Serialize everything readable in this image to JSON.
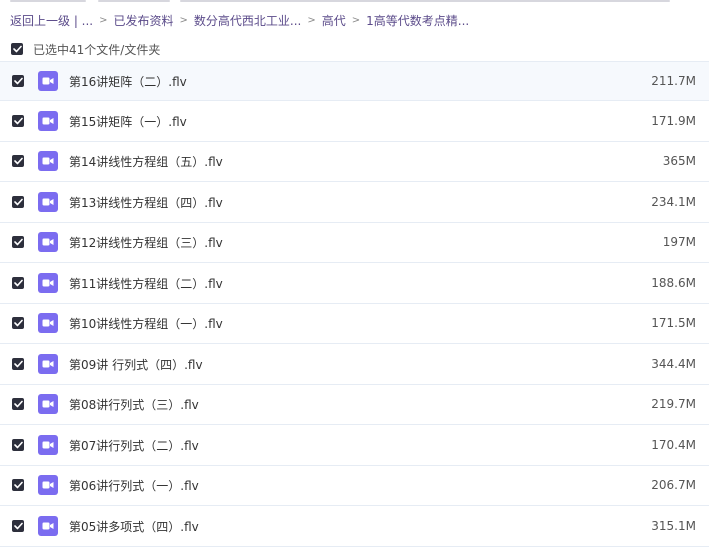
{
  "breadcrumb": {
    "items": [
      "返回上一级 | ...",
      "已发布资料",
      "数分高代西北工业...",
      "高代",
      "1高等代数考点精..."
    ],
    "separator": ">"
  },
  "selection": {
    "label": "已选中41个文件/文件夹"
  },
  "files": [
    {
      "name": "第16讲矩阵（二）.flv",
      "size": "211.7M"
    },
    {
      "name": "第15讲矩阵（一）.flv",
      "size": "171.9M"
    },
    {
      "name": "第14讲线性方程组（五）.flv",
      "size": "365M"
    },
    {
      "name": "第13讲线性方程组（四）.flv",
      "size": "234.1M"
    },
    {
      "name": "第12讲线性方程组（三）.flv",
      "size": "197M"
    },
    {
      "name": "第11讲线性方程组（二）.flv",
      "size": "188.6M"
    },
    {
      "name": "第10讲线性方程组（一）.flv",
      "size": "171.5M"
    },
    {
      "name": "第09讲 行列式（四）.flv",
      "size": "344.4M"
    },
    {
      "name": "第08讲行列式（三）.flv",
      "size": "219.7M"
    },
    {
      "name": "第07讲行列式（二）.flv",
      "size": "170.4M"
    },
    {
      "name": "第06讲行列式（一）.flv",
      "size": "206.7M"
    },
    {
      "name": "第05讲多项式（四）.flv",
      "size": "315.1M"
    }
  ],
  "colors": {
    "accent": "#7b6cf0",
    "checkbox": "#2d2f3c",
    "link": "#5b4b8a"
  },
  "icons": {
    "file": "video-file-icon",
    "checkbox": "checkbox-checked-icon"
  }
}
